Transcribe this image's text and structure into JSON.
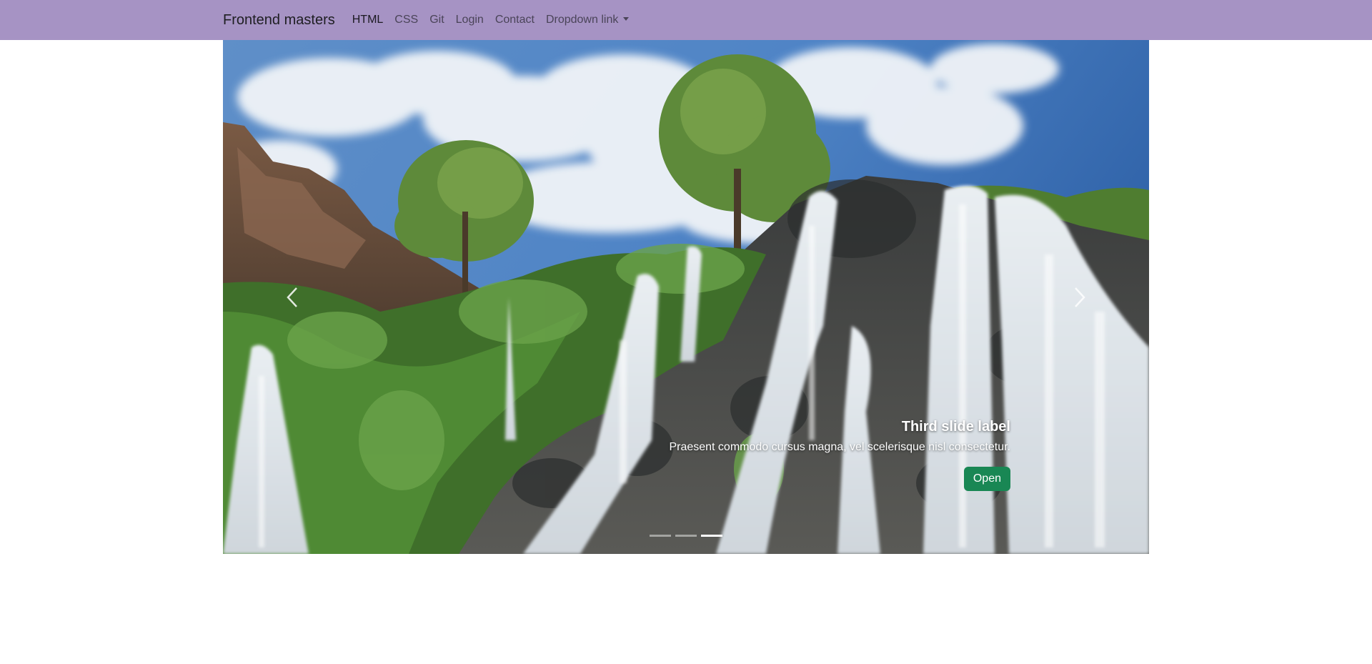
{
  "navbar": {
    "brand": "Frontend masters",
    "links": [
      "HTML",
      "CSS",
      "Git",
      "Login",
      "Contact"
    ],
    "dropdown_label": "Dropdown link"
  },
  "carousel": {
    "caption_title": "Third slide label",
    "caption_text": "Praesent commodo cursus magna, vel scelerisque nisl consectetur.",
    "button_label": "Open",
    "active_slide": 3,
    "slide_count": 3
  },
  "colors": {
    "navbar_bg": "#a693c4",
    "button_bg": "#198754"
  },
  "icons": {
    "prev": "chevron-left-icon",
    "next": "chevron-right-icon",
    "dropdown": "caret-down-icon"
  }
}
